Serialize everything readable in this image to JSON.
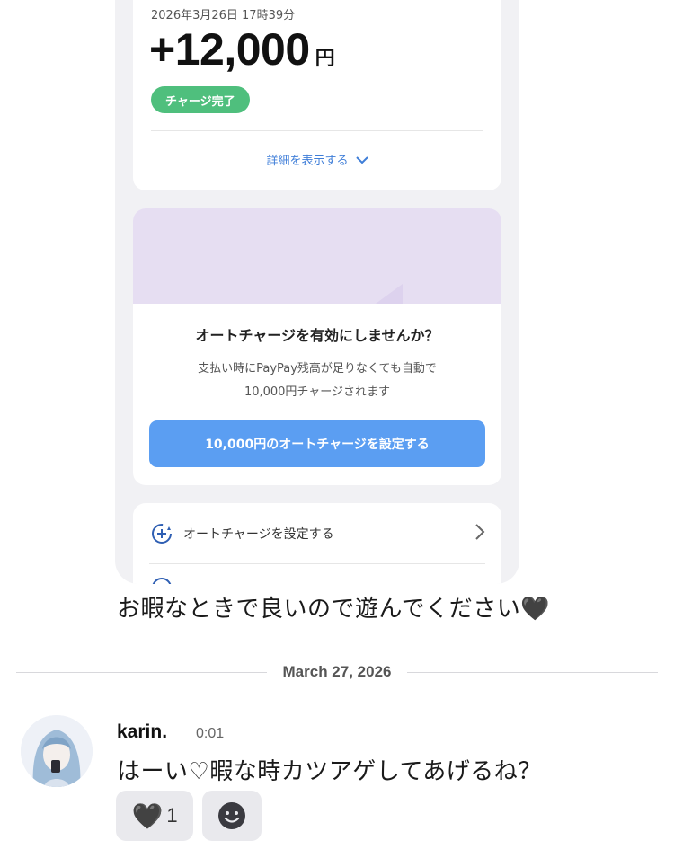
{
  "transaction": {
    "datetime": "2026年3月26日 17時39分",
    "amount": "+12,000",
    "currency": "円",
    "status_badge": "チャージ完了",
    "details_link": "詳細を表示する"
  },
  "auto_charge_promo": {
    "title": "オートチャージを有効にしませんか？",
    "description_line1": "支払い時にPayPay残高が足りなくても自動で",
    "description_line2": "10,000円チャージされます",
    "button_label": "10,000円のオートチャージを設定する"
  },
  "settings_list": {
    "items": [
      {
        "label": "オートチャージを設定する",
        "icon": "auto-charge-icon"
      }
    ]
  },
  "chat": {
    "previous_message": "お暇なときで良いので遊んでください🖤",
    "date_separator": "March 27, 2026",
    "message": {
      "author": "karin.",
      "time": "0:01",
      "text": "はーい♡暇な時カツアゲしてあげるね？"
    },
    "reactions": [
      {
        "emoji": "🖤",
        "count": "1"
      },
      {
        "emoji": "add-reaction-icon"
      }
    ]
  },
  "colors": {
    "badge_green": "#4fbf7d",
    "button_blue": "#5b9ef2",
    "link_blue": "#3f7ed8",
    "banner_lavender": "#e6def2"
  }
}
